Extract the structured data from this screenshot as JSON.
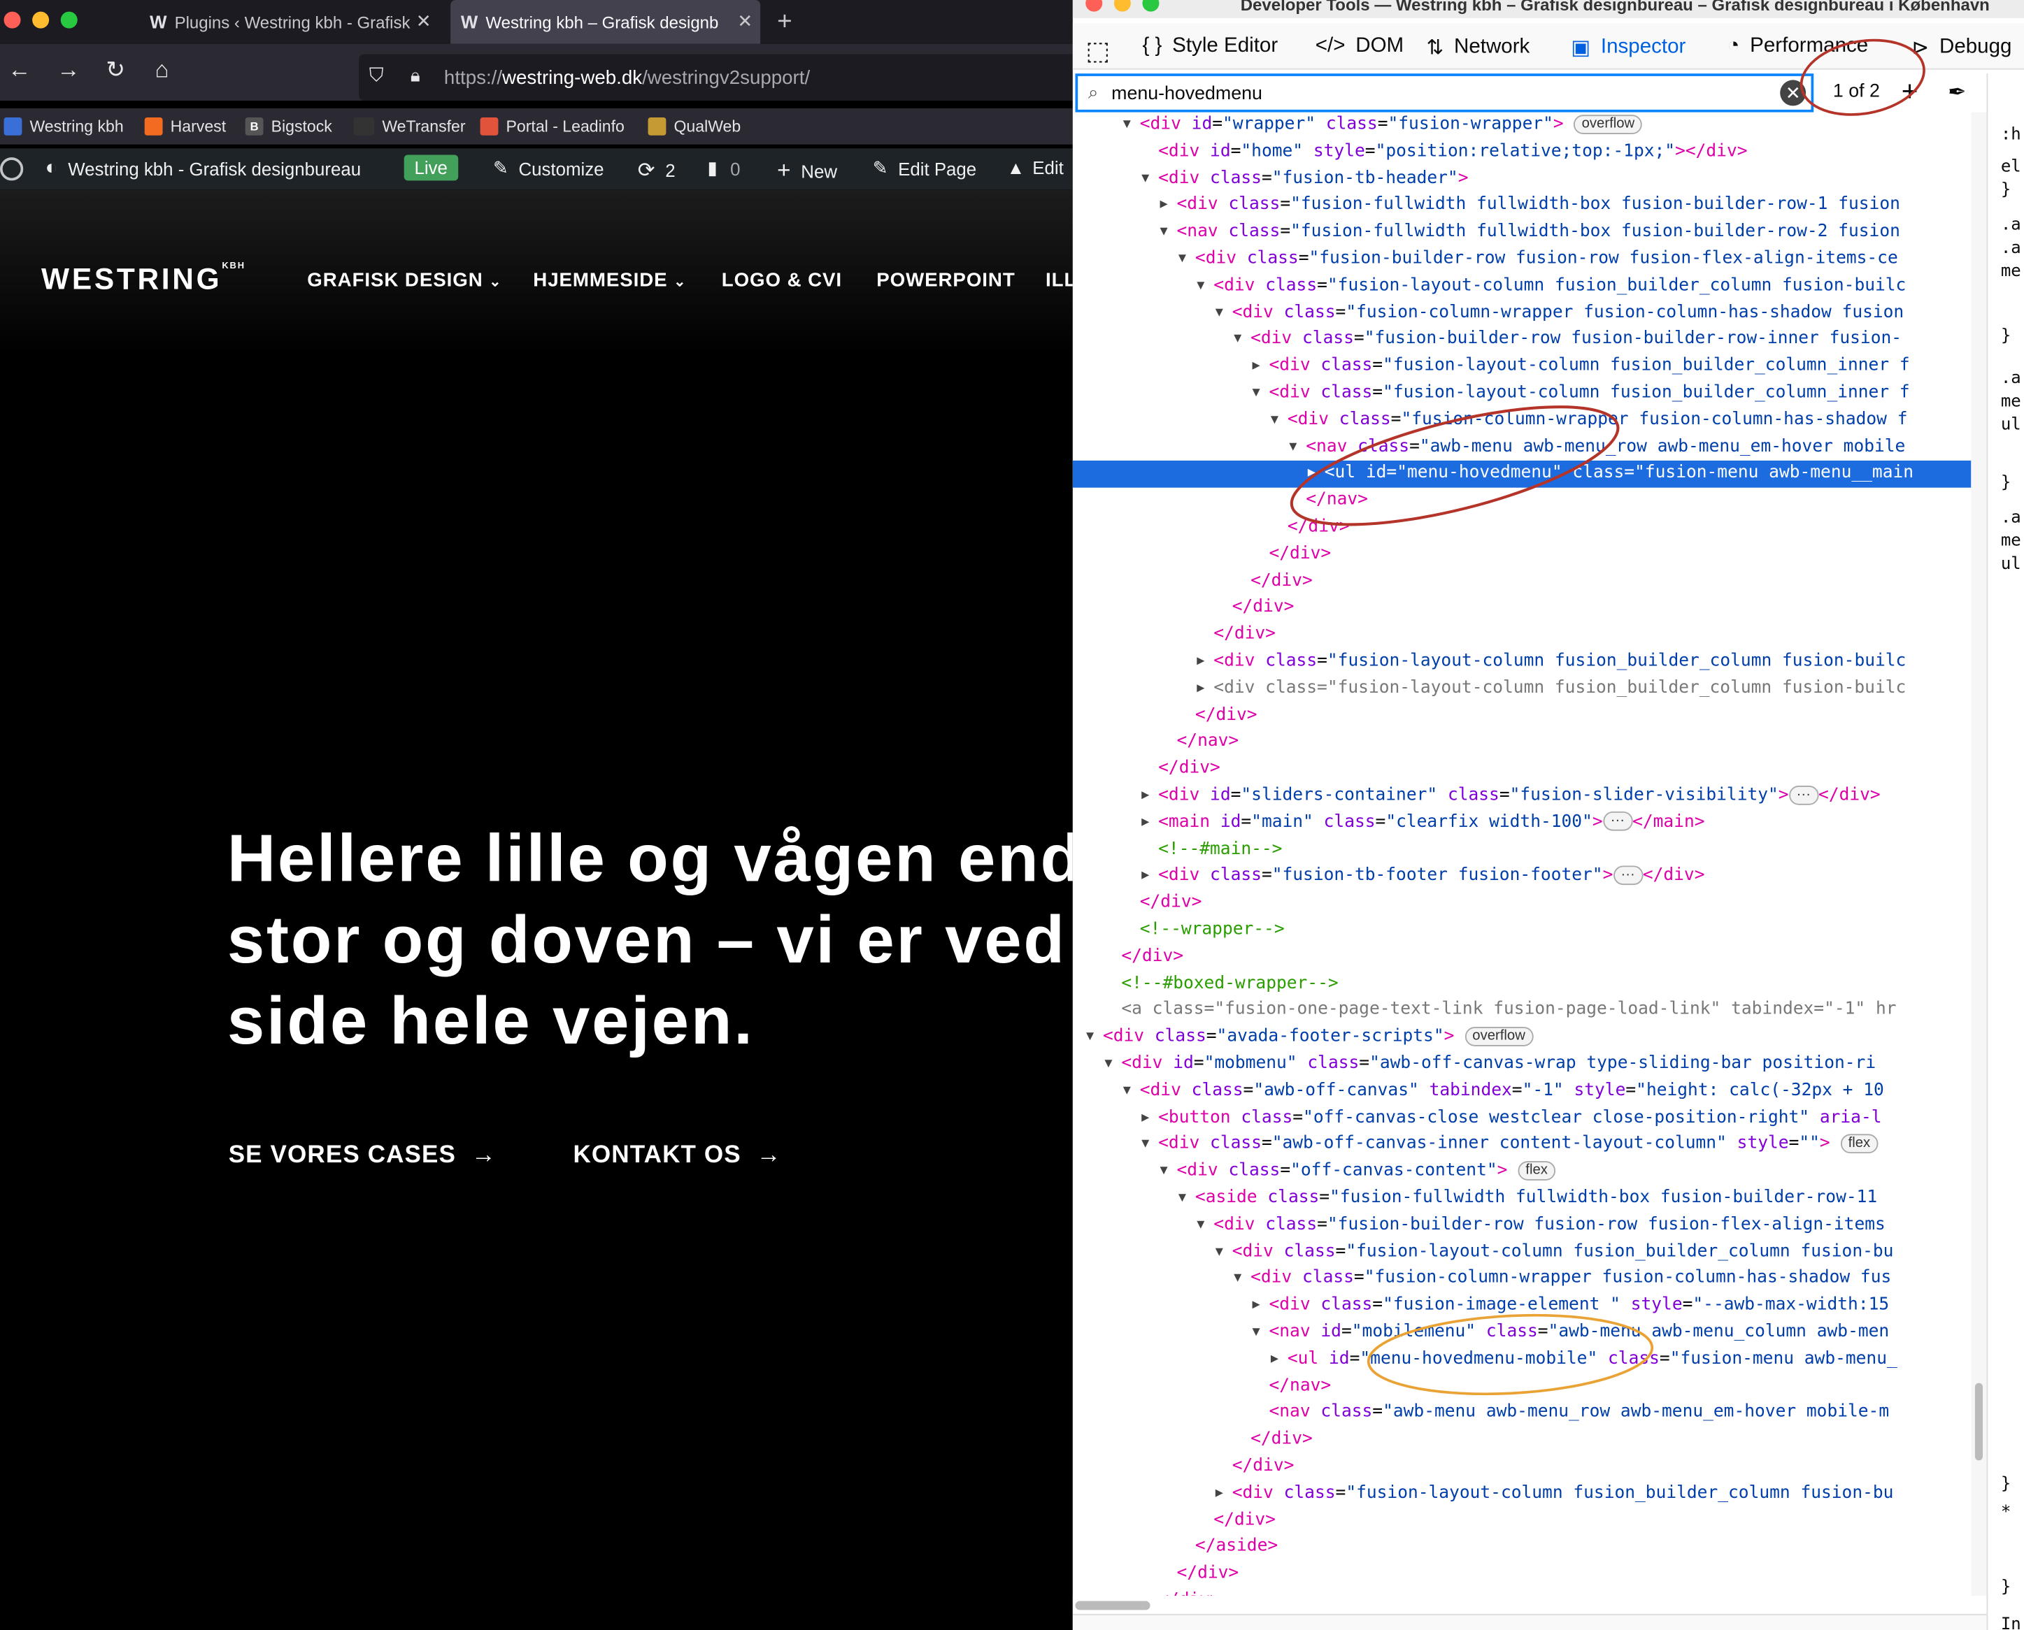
{
  "browser": {
    "tabs": [
      {
        "label": "Plugins ‹ Westring kbh - Grafisk"
      },
      {
        "label": "Westring kbh – Grafisk designb"
      }
    ],
    "url_prefix": "https://",
    "url_host": "westring-web.dk",
    "url_path": "/westringv2support/",
    "bookmarks": [
      "Westring kbh",
      "Harvest",
      "Bigstock",
      "WeTransfer",
      "Portal - Leadinfo",
      "QualWeb"
    ]
  },
  "wp_bar": {
    "site_name": "Westring kbh - Grafisk designbureau",
    "live": "Live",
    "customize": "Customize",
    "updates": "2",
    "comments": "0",
    "new": "New",
    "edit_page": "Edit Page",
    "edit": "Edit"
  },
  "site": {
    "logo": "WESTRING",
    "logo_sup": "KBH",
    "menu": [
      "GRAFISK DESIGN",
      "HJEMMESIDE",
      "LOGO & CVI",
      "POWERPOINT",
      "ILL"
    ],
    "headline": [
      "Hellere lille og vågen end",
      "stor og doven – vi er ved",
      "side hele vejen."
    ],
    "cta1": "SE VORES CASES",
    "cta2": "KONTAKT OS"
  },
  "devtools": {
    "title": "Developer Tools — Westring kbh – Grafisk designbureau – Grafisk designbureau i København",
    "tabs": [
      "Style Editor",
      "DOM",
      "Network",
      "Inspector",
      "Performance",
      "Debugg"
    ],
    "active_tab": "Inspector",
    "search_value": "menu-hovedmenu",
    "match_count": "1 of 2",
    "selected_line": 13,
    "right_pane": [
      ":h",
      "el",
      "}",
      ".a",
      ".a",
      "me",
      "}",
      ".a",
      "me",
      "ul",
      "}",
      ".a",
      "me",
      "ul",
      "}",
      "*",
      "}",
      "In"
    ],
    "tree": [
      {
        "d": 0,
        "t": "open",
        "html": "<span class='tg'>&lt;div</span> <span class='an'>id</span>=<span class='av'>\"wrapper\"</span> <span class='an'>class</span>=<span class='av'>\"fusion-wrapper\"</span><span class='tg'>&gt;</span> <span class='badge'>overflow</span>"
      },
      {
        "d": 1,
        "t": "none",
        "html": "<span class='tg'>&lt;div</span> <span class='an'>id</span>=<span class='av'>\"home\"</span> <span class='an'>style</span>=<span class='av'>\"position:relative;top:-1px;\"</span><span class='tg'>&gt;&lt;/div&gt;</span>"
      },
      {
        "d": 1,
        "t": "open",
        "html": "<span class='tg'>&lt;div</span> <span class='an'>class</span>=<span class='av'>\"fusion-tb-header\"</span><span class='tg'>&gt;</span>"
      },
      {
        "d": 2,
        "t": "closed",
        "html": "<span class='tg'>&lt;div</span> <span class='an'>class</span>=<span class='av'>\"fusion-fullwidth fullwidth-box fusion-builder-row-1 fusion</span>"
      },
      {
        "d": 2,
        "t": "open",
        "html": "<span class='tg'>&lt;nav</span> <span class='an'>class</span>=<span class='av'>\"fusion-fullwidth fullwidth-box fusion-builder-row-2 fusion</span>"
      },
      {
        "d": 3,
        "t": "open",
        "html": "<span class='tg'>&lt;div</span> <span class='an'>class</span>=<span class='av'>\"fusion-builder-row fusion-row fusion-flex-align-items-ce</span>"
      },
      {
        "d": 4,
        "t": "open",
        "html": "<span class='tg'>&lt;div</span> <span class='an'>class</span>=<span class='av'>\"fusion-layout-column fusion_builder_column fusion-builc</span>"
      },
      {
        "d": 5,
        "t": "open",
        "html": "<span class='tg'>&lt;div</span> <span class='an'>class</span>=<span class='av'>\"fusion-column-wrapper fusion-column-has-shadow fusion</span>"
      },
      {
        "d": 6,
        "t": "open",
        "html": "<span class='tg'>&lt;div</span> <span class='an'>class</span>=<span class='av'>\"fusion-builder-row fusion-builder-row-inner fusion-</span>"
      },
      {
        "d": 7,
        "t": "closed",
        "html": "<span class='tg'>&lt;div</span> <span class='an'>class</span>=<span class='av'>\"fusion-layout-column fusion_builder_column_inner f</span>"
      },
      {
        "d": 7,
        "t": "open",
        "html": "<span class='tg'>&lt;div</span> <span class='an'>class</span>=<span class='av'>\"fusion-layout-column fusion_builder_column_inner f</span>"
      },
      {
        "d": 8,
        "t": "open",
        "html": "<span class='tg'>&lt;div</span> <span class='an'>class</span>=<span class='av'>\"fusion-column-wrapper fusion-column-has-shadow f</span>"
      },
      {
        "d": 9,
        "t": "open",
        "html": "<span class='tg'>&lt;nav</span> <span class='an'>class</span>=<span class='av'>\"awb-menu awb-menu_row awb-menu_em-hover mobile</span>"
      },
      {
        "d": 10,
        "t": "closed",
        "html": "<span class='tg'>&lt;ul</span> <span class='an'>id</span>=<span class='av'>\"menu-hovedmenu\"</span> <span class='an'>class</span>=<span class='av'>\"fusion-menu awb-menu__main</span>"
      },
      {
        "d": 9,
        "t": "none",
        "html": "<span class='tg'>&lt;/nav&gt;</span>"
      },
      {
        "d": 8,
        "t": "none",
        "html": "<span class='tg'>&lt;/div&gt;</span>"
      },
      {
        "d": 7,
        "t": "none",
        "html": "<span class='tg'>&lt;/div&gt;</span>"
      },
      {
        "d": 6,
        "t": "none",
        "html": "<span class='tg'>&lt;/div&gt;</span>"
      },
      {
        "d": 5,
        "t": "none",
        "html": "<span class='tg'>&lt;/div&gt;</span>"
      },
      {
        "d": 4,
        "t": "none",
        "html": "<span class='tg'>&lt;/div&gt;</span>"
      },
      {
        "d": 4,
        "t": "closed",
        "html": "<span class='tg'>&lt;div</span> <span class='an'>class</span>=<span class='av'>\"fusion-layout-column fusion_builder_column fusion-builc</span>"
      },
      {
        "d": 4,
        "t": "closed",
        "html": "<span class='pc'>&lt;div class=\"fusion-layout-column fusion_builder_column fusion-builc</span>"
      },
      {
        "d": 3,
        "t": "none",
        "html": "<span class='tg'>&lt;/div&gt;</span>"
      },
      {
        "d": 2,
        "t": "none",
        "html": "<span class='tg'>&lt;/nav&gt;</span>"
      },
      {
        "d": 1,
        "t": "none",
        "html": "<span class='tg'>&lt;/div&gt;</span>"
      },
      {
        "d": 1,
        "t": "closed",
        "html": "<span class='tg'>&lt;div</span> <span class='an'>id</span>=<span class='av'>\"sliders-container\"</span> <span class='an'>class</span>=<span class='av'>\"fusion-slider-visibility\"</span><span class='tg'>&gt;</span><span class='badge'>···</span><span class='tg'>&lt;/div&gt;</span>"
      },
      {
        "d": 1,
        "t": "closed",
        "html": "<span class='tg'>&lt;main</span> <span class='an'>id</span>=<span class='av'>\"main\"</span> <span class='an'>class</span>=<span class='av'>\"clearfix width-100\"</span><span class='tg'>&gt;</span><span class='badge'>···</span><span class='tg'>&lt;/main&gt;</span>"
      },
      {
        "d": 1,
        "t": "none",
        "html": "<span class='cm'>&lt;!--#main--&gt;</span>"
      },
      {
        "d": 1,
        "t": "closed",
        "html": "<span class='tg'>&lt;div</span> <span class='an'>class</span>=<span class='av'>\"fusion-tb-footer fusion-footer\"</span><span class='tg'>&gt;</span><span class='badge'>···</span><span class='tg'>&lt;/div&gt;</span>"
      },
      {
        "d": 0,
        "t": "none",
        "html": "<span class='tg'>&lt;/div&gt;</span>"
      },
      {
        "d": 0,
        "t": "none",
        "html": "<span class='cm'>&lt;!--wrapper--&gt;</span>"
      },
      {
        "d": -1,
        "t": "none",
        "html": "<span class='tg'>&lt;/div&gt;</span>"
      },
      {
        "d": -1,
        "t": "none",
        "html": "<span class='cm'>&lt;!--#boxed-wrapper--&gt;</span>"
      },
      {
        "d": -1,
        "t": "none",
        "html": "<span class='pc'>&lt;a class=\"fusion-one-page-text-link fusion-page-load-link\" tabindex=\"-1\" hr</span>"
      },
      {
        "d": -2,
        "t": "open",
        "html": "<span class='tg'>&lt;div</span> <span class='an'>class</span>=<span class='av'>\"avada-footer-scripts\"</span><span class='tg'>&gt;</span> <span class='badge'>overflow</span>"
      },
      {
        "d": -1,
        "t": "open",
        "html": "<span class='tg'>&lt;div</span> <span class='an'>id</span>=<span class='av'>\"mobmenu\"</span> <span class='an'>class</span>=<span class='av'>\"awb-off-canvas-wrap type-sliding-bar position-ri</span>"
      },
      {
        "d": 0,
        "t": "open",
        "html": "<span class='tg'>&lt;div</span> <span class='an'>class</span>=<span class='av'>\"awb-off-canvas\"</span> <span class='an'>tabindex</span>=<span class='av'>\"-1\"</span> <span class='an'>style</span>=<span class='av'>\"height: calc(-32px + 10</span>"
      },
      {
        "d": 1,
        "t": "closed",
        "html": "<span class='tg'>&lt;button</span> <span class='an'>class</span>=<span class='av'>\"off-canvas-close westclear close-position-right\"</span> <span class='an'>aria-l</span>"
      },
      {
        "d": 1,
        "t": "open",
        "html": "<span class='tg'>&lt;div</span> <span class='an'>class</span>=<span class='av'>\"awb-off-canvas-inner content-layout-column\"</span> <span class='an'>style</span>=<span class='av'>\"\"</span><span class='tg'>&gt;</span> <span class='badge'>flex</span>"
      },
      {
        "d": 2,
        "t": "open",
        "html": "<span class='tg'>&lt;div</span> <span class='an'>class</span>=<span class='av'>\"off-canvas-content\"</span><span class='tg'>&gt;</span> <span class='badge'>flex</span>"
      },
      {
        "d": 3,
        "t": "open",
        "html": "<span class='tg'>&lt;aside</span> <span class='an'>class</span>=<span class='av'>\"fusion-fullwidth fullwidth-box fusion-builder-row-11</span>"
      },
      {
        "d": 4,
        "t": "open",
        "html": "<span class='tg'>&lt;div</span> <span class='an'>class</span>=<span class='av'>\"fusion-builder-row fusion-row fusion-flex-align-items</span>"
      },
      {
        "d": 5,
        "t": "open",
        "html": "<span class='tg'>&lt;div</span> <span class='an'>class</span>=<span class='av'>\"fusion-layout-column fusion_builder_column fusion-bu</span>"
      },
      {
        "d": 6,
        "t": "open",
        "html": "<span class='tg'>&lt;div</span> <span class='an'>class</span>=<span class='av'>\"fusion-column-wrapper fusion-column-has-shadow fus</span>"
      },
      {
        "d": 7,
        "t": "closed",
        "html": "<span class='tg'>&lt;div</span> <span class='an'>class</span>=<span class='av'>\"fusion-image-element \"</span> <span class='an'>style</span>=<span class='av'>\"--awb-max-width:15</span>"
      },
      {
        "d": 7,
        "t": "open",
        "html": "<span class='tg'>&lt;nav</span> <span class='an'>id</span>=<span class='av'>\"mobilemenu\"</span> <span class='an'>class</span>=<span class='av'>\"awb-menu awb-menu_column awb-men</span>"
      },
      {
        "d": 8,
        "t": "closed",
        "html": "<span class='tg'>&lt;ul</span> <span class='an'>id</span>=<span class='av'>\"menu-hovedmenu-mobile\"</span> <span class='an'>class</span>=<span class='av'>\"fusion-menu awb-menu_</span>"
      },
      {
        "d": 7,
        "t": "none",
        "html": "<span class='tg'>&lt;/nav&gt;</span>"
      },
      {
        "d": 7,
        "t": "none",
        "html": "<span class='tg'>&lt;nav</span> <span class='an'>class</span>=<span class='av'>\"awb-menu awb-menu_row awb-menu_em-hover mobile-m</span>"
      },
      {
        "d": 6,
        "t": "none",
        "html": "<span class='tg'>&lt;/div&gt;</span>"
      },
      {
        "d": 5,
        "t": "none",
        "html": "<span class='tg'>&lt;/div&gt;</span>"
      },
      {
        "d": 5,
        "t": "closed",
        "html": "<span class='tg'>&lt;div</span> <span class='an'>class</span>=<span class='av'>\"fusion-layout-column fusion_builder_column fusion-bu</span>"
      },
      {
        "d": 4,
        "t": "none",
        "html": "<span class='tg'>&lt;/div&gt;</span>"
      },
      {
        "d": 3,
        "t": "none",
        "html": "<span class='tg'>&lt;/aside&gt;</span>"
      },
      {
        "d": 2,
        "t": "none",
        "html": "<span class='tg'>&lt;/div&gt;</span>"
      },
      {
        "d": 1,
        "t": "none",
        "html": "<span class='tg'>&lt;/div&gt;</span>"
      }
    ]
  },
  "colors": {
    "devtools_accent": "#0a84ff",
    "selection": "#1c6ce0",
    "annotation_red": "#b5342a",
    "annotation_orange": "#e9a233",
    "wp_live": "#42a05b"
  }
}
